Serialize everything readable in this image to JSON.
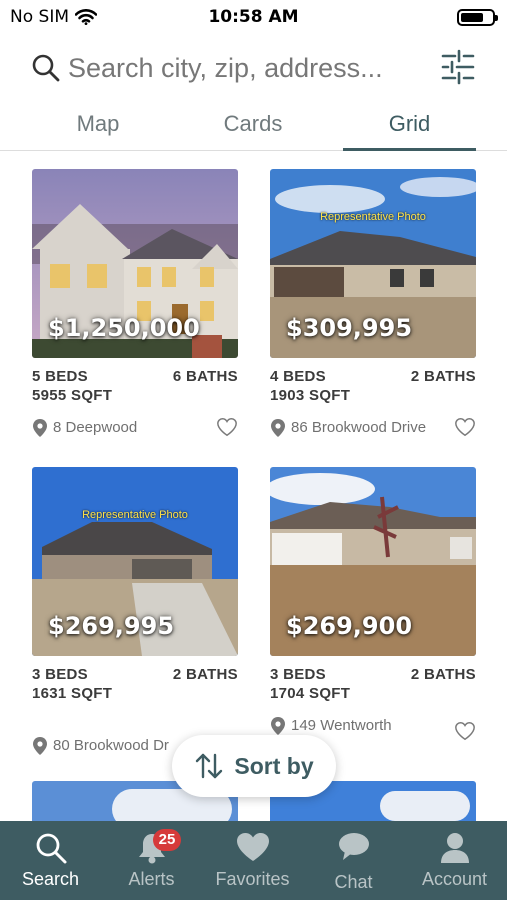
{
  "status_bar": {
    "carrier": "No SIM",
    "time": "10:58 AM"
  },
  "search": {
    "placeholder": "Search city, zip, address..."
  },
  "tabs": [
    {
      "label": "Map"
    },
    {
      "label": "Cards"
    },
    {
      "label": "Grid"
    }
  ],
  "listings": [
    {
      "price": "$1,250,000",
      "beds": "5 BEDS",
      "baths": "6 BATHS",
      "sqft": "5955 SQFT",
      "address": "8 Deepwood"
    },
    {
      "price": "$309,995",
      "beds": "4 BEDS",
      "baths": "2 BATHS",
      "sqft": "1903 SQFT",
      "address": "86 Brookwood Drive",
      "photo_label": "Representative Photo"
    },
    {
      "price": "$269,995",
      "beds": "3 BEDS",
      "baths": "2 BATHS",
      "sqft": "1631 SQFT",
      "address": "80 Brookwood Dr",
      "photo_label": "Representative Photo"
    },
    {
      "price": "$269,900",
      "beds": "3 BEDS",
      "baths": "2 BATHS",
      "sqft": "1704 SQFT",
      "address": "149 Wentworth"
    }
  ],
  "sort_button": {
    "label": "Sort by"
  },
  "bottom_nav": [
    {
      "label": "Search"
    },
    {
      "label": "Alerts",
      "badge": "25"
    },
    {
      "label": "Favorites"
    },
    {
      "label": "Chat"
    },
    {
      "label": "Account"
    }
  ],
  "colors": {
    "accent": "#3e5c62",
    "badge": "#d63a3a"
  }
}
